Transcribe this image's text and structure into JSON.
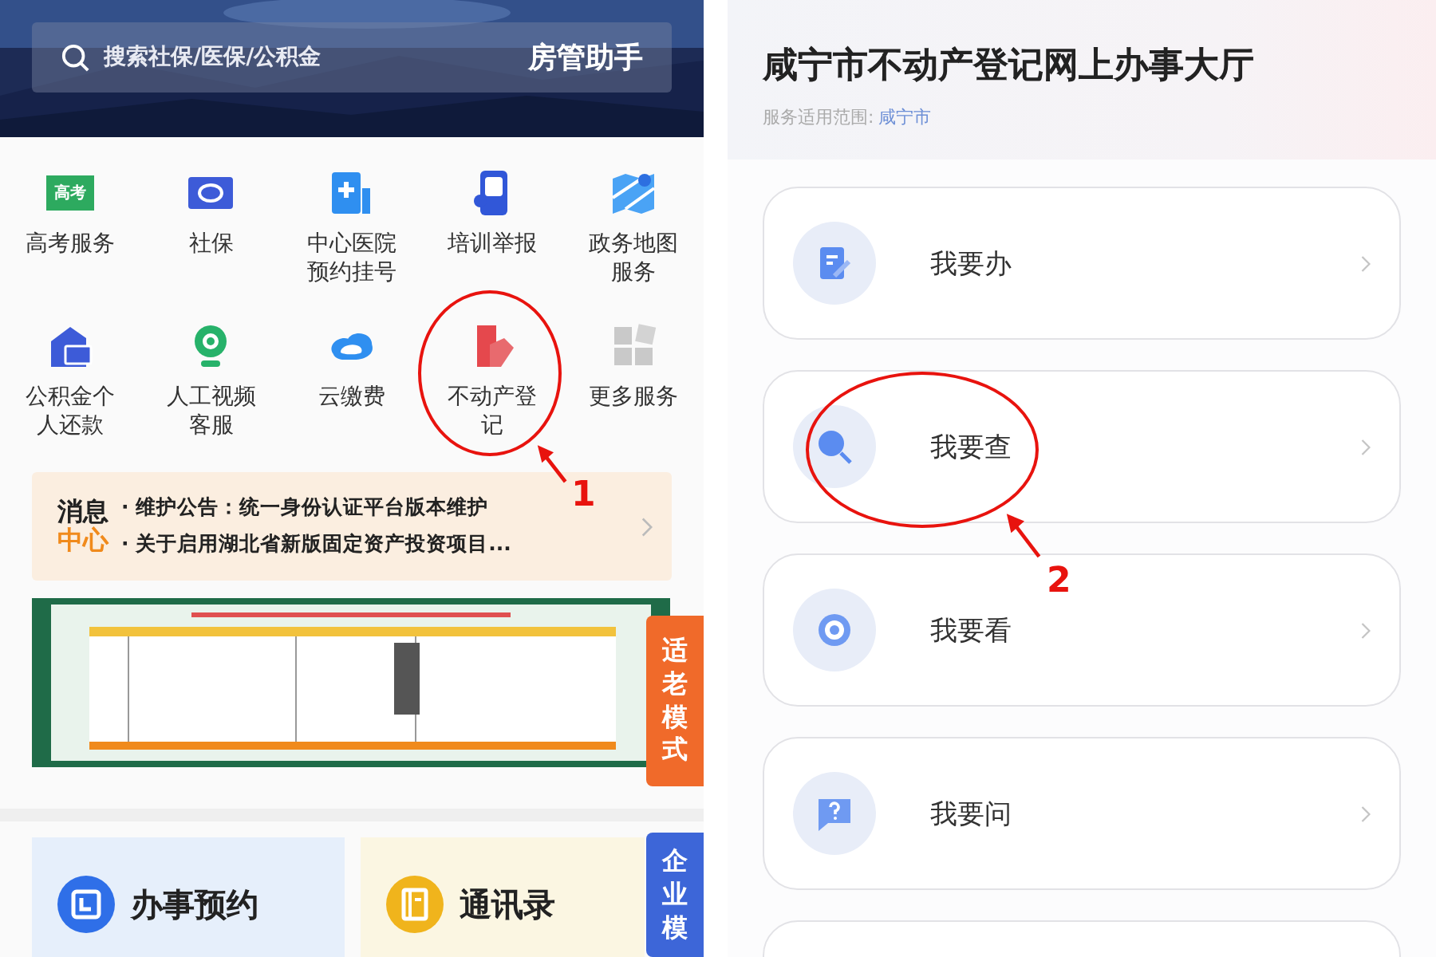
{
  "left_screen": {
    "search": {
      "placeholder": "搜索社保/医保/公积金"
    },
    "app_title": "房管助手",
    "services": [
      {
        "label": "高考服务",
        "kind": "exam",
        "icon_text": "高考"
      },
      {
        "label": "社保",
        "kind": "social"
      },
      {
        "label": "中心医院预约挂号",
        "kind": "hospital"
      },
      {
        "label": "培训举报",
        "kind": "phone"
      },
      {
        "label": "政务地图服务",
        "kind": "map"
      },
      {
        "label": "公积金个人还款",
        "kind": "house"
      },
      {
        "label": "人工视频客服",
        "kind": "camera"
      },
      {
        "label": "云缴费",
        "kind": "cloud"
      },
      {
        "label": "不动产登记",
        "kind": "property"
      },
      {
        "label": "更多服务",
        "kind": "more"
      }
    ],
    "annotation": "1",
    "notice": {
      "badge_top": "消息",
      "badge_bottom": "中心",
      "items": [
        "· 维护公告：统一身份认证平台版本维护",
        "· 关于启用湖北省新版固定资产投资项目..."
      ]
    },
    "elder_mode_tab": "适老模式",
    "shortcuts": [
      {
        "label": "办事预约",
        "kind": "calendar"
      },
      {
        "label": "通讯录",
        "kind": "contacts"
      }
    ],
    "enterprise_tab": "企业模"
  },
  "right_screen": {
    "title": "咸宁市不动产登记网上办事大厅",
    "scope_label": "服务适用范围:",
    "scope_value": "咸宁市",
    "menu": [
      {
        "label": "我要办",
        "kind": "edit"
      },
      {
        "label": "我要查",
        "kind": "search"
      },
      {
        "label": "我要看",
        "kind": "eye"
      },
      {
        "label": "我要问",
        "kind": "question"
      },
      {
        "kind": "blank"
      }
    ],
    "annotation": "2"
  }
}
